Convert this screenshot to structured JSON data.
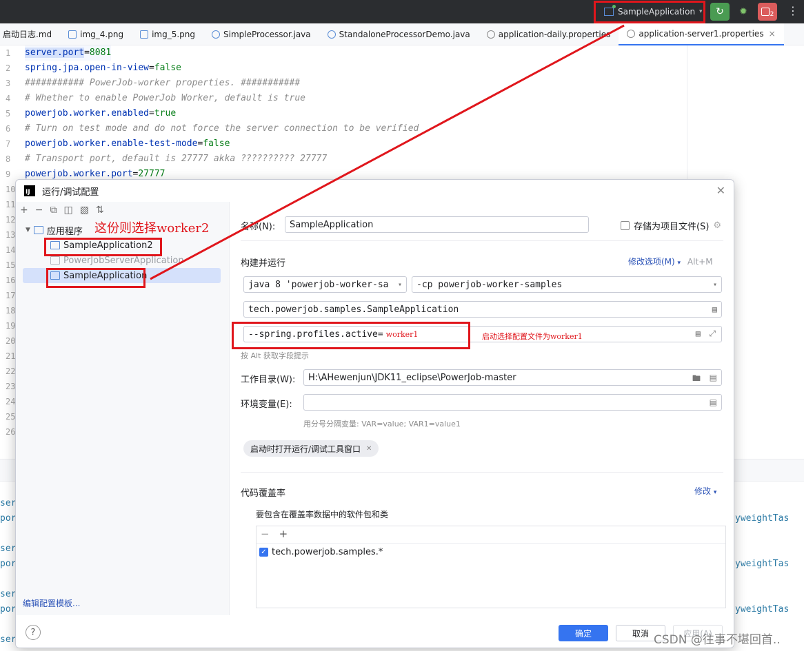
{
  "topbar": {
    "run_config": "SampleApplication",
    "run_icon": "rerun-icon",
    "debug_icon": "bug-icon",
    "stop_label": "2"
  },
  "tabs": [
    {
      "label": "启动日志.md",
      "icon": "markdown-icon"
    },
    {
      "label": "img_4.png",
      "icon": "image-icon"
    },
    {
      "label": "img_5.png",
      "icon": "image-icon"
    },
    {
      "label": "SimpleProcessor.java",
      "icon": "java-class-icon"
    },
    {
      "label": "StandaloneProcessorDemo.java",
      "icon": "java-class-icon"
    },
    {
      "label": "application-daily.properties",
      "icon": "properties-icon"
    },
    {
      "label": "application-server1.properties",
      "icon": "properties-icon"
    }
  ],
  "editor": {
    "line_numbers": [
      "1",
      "2",
      "3",
      "4",
      "5",
      "6",
      "7",
      "8",
      "9",
      "10",
      "11",
      "12",
      "13",
      "14",
      "15",
      "16",
      "17",
      "18",
      "19",
      "20",
      "21",
      "22",
      "23",
      "24",
      "25",
      "26"
    ],
    "lines": [
      {
        "key": "server.port",
        "eq": "=",
        "val": "8081"
      },
      {
        "key": "spring.jpa.open-in-view",
        "eq": "=",
        "val": "false"
      },
      {
        "comment": "########### PowerJob-worker properties. ###########"
      },
      {
        "comment": "# Whether to enable PowerJob Worker, default is true"
      },
      {
        "key": "powerjob.worker.enabled",
        "eq": "=",
        "val": "true"
      },
      {
        "comment": "# Turn on test mode and do not force the server connection to be verified"
      },
      {
        "key": "powerjob.worker.enable-test-mode",
        "eq": "=",
        "val": "false"
      },
      {
        "comment": "# Transport port, default is 27777 akka ?????????? 27777"
      },
      {
        "key": "powerjob.worker.port",
        "eq": "=",
        "val": "27777"
      }
    ]
  },
  "console": {
    "left_fragments": [
      "ser",
      "por",
      "ser",
      "por",
      "ser",
      "por",
      "ser"
    ],
    "right_fragments": [
      "yweightTas",
      "yweightTas",
      "yweightTas"
    ]
  },
  "dialog": {
    "title": "运行/调试配置",
    "tree": {
      "group": "应用程序",
      "items": [
        "SampleApplication2",
        "PowerJobServerApplication",
        "SampleApplication"
      ],
      "selected_index": 2
    },
    "edit_templates": "编辑配置模板...",
    "name_label": "名称(N):",
    "name_value": "SampleApplication",
    "store_as_project_file": "存储为项目文件(S)",
    "build_run_title": "构建并运行",
    "modify_options": "修改选项(M)",
    "modify_shortcut": "Alt+M",
    "jdk_value": "java 8  'powerjob-worker-sa",
    "classpath_value": "-cp  powerjob-worker-samples",
    "main_class": "tech.powerjob.samples.SampleApplication",
    "program_args": "--spring.profiles.active=",
    "program_args_value": "worker1",
    "field_hint": "按 Alt 获取字段提示",
    "workdir_label": "工作目录(W):",
    "workdir_value": "H:\\AHewenjun\\JDK11_eclipse\\PowerJob-master",
    "env_label": "环境变量(E):",
    "env_value": "",
    "env_hint": "用分号分隔变量: VAR=value; VAR1=value1",
    "open_tool_window_chip": "启动时打开运行/调试工具窗口",
    "coverage_title": "代码覆盖率",
    "coverage_modify": "修改",
    "coverage_include_label": "要包含在覆盖率数据中的软件包和类",
    "coverage_pattern": "tech.powerjob.samples.*",
    "coverage_pattern_checked": true,
    "ok": "确定",
    "cancel": "取消",
    "apply": "应用(A)"
  },
  "annotations": {
    "pick_worker2": "这份则选择worker2",
    "pick_worker1": "启动选择配置文件为worker1",
    "color": "#e0161c"
  },
  "watermark": "CSDN @往事不堪回首.."
}
